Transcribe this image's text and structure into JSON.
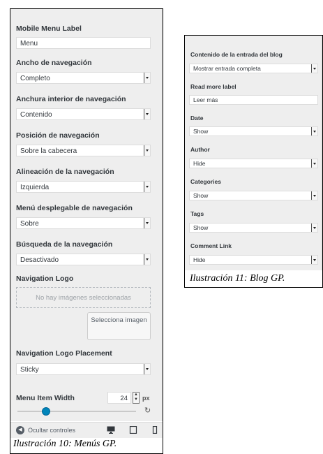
{
  "menus_panel": {
    "mobile_menu_label": {
      "label": "Mobile Menu Label",
      "value": "Menu"
    },
    "nav_width": {
      "label": "Ancho de navegación",
      "value": "Completo"
    },
    "nav_inner_width": {
      "label": "Anchura interior de navegación",
      "value": "Contenido"
    },
    "nav_position": {
      "label": "Posición de navegación",
      "value": "Sobre la cabecera"
    },
    "nav_alignment": {
      "label": "Alineación de la navegación",
      "value": "Izquierda"
    },
    "nav_dropdown": {
      "label": "Menú desplegable de navegación",
      "value": "Sobre"
    },
    "nav_search": {
      "label": "Búsqueda de la navegación",
      "value": "Desactivado"
    },
    "nav_logo": {
      "label": "Navigation Logo",
      "empty_text": "No hay imágenes seleccionadas",
      "select_button": "Selecciona imagen"
    },
    "nav_logo_placement": {
      "label": "Navigation Logo Placement",
      "value": "Sticky"
    },
    "menu_item_width": {
      "label": "Menu Item Width",
      "value": "24",
      "unit": "px",
      "slider_fraction": 0.24
    },
    "footer": {
      "hide_controls": "Ocultar controles"
    },
    "caption": "Ilustración 10: Menús GP."
  },
  "blog_panel": {
    "content": {
      "label": "Contenido de la entrada del blog",
      "value": "Mostrar entrada completa"
    },
    "read_more": {
      "label": "Read more label",
      "value": "Leer más"
    },
    "date": {
      "label": "Date",
      "value": "Show"
    },
    "author": {
      "label": "Author",
      "value": "Hide"
    },
    "categories": {
      "label": "Categories",
      "value": "Show"
    },
    "tags": {
      "label": "Tags",
      "value": "Show"
    },
    "comment_link": {
      "label": "Comment Link",
      "value": "Hide"
    },
    "caption": "Ilustración 11: Blog GP."
  },
  "colors": {
    "accent": "#0085ba",
    "panel_bg": "#eeeeee"
  },
  "icons": [
    "chevron-down-icon",
    "circle-left-icon",
    "desktop-icon",
    "tablet-icon",
    "mobile-icon",
    "reset-icon",
    "spinner-icon"
  ]
}
